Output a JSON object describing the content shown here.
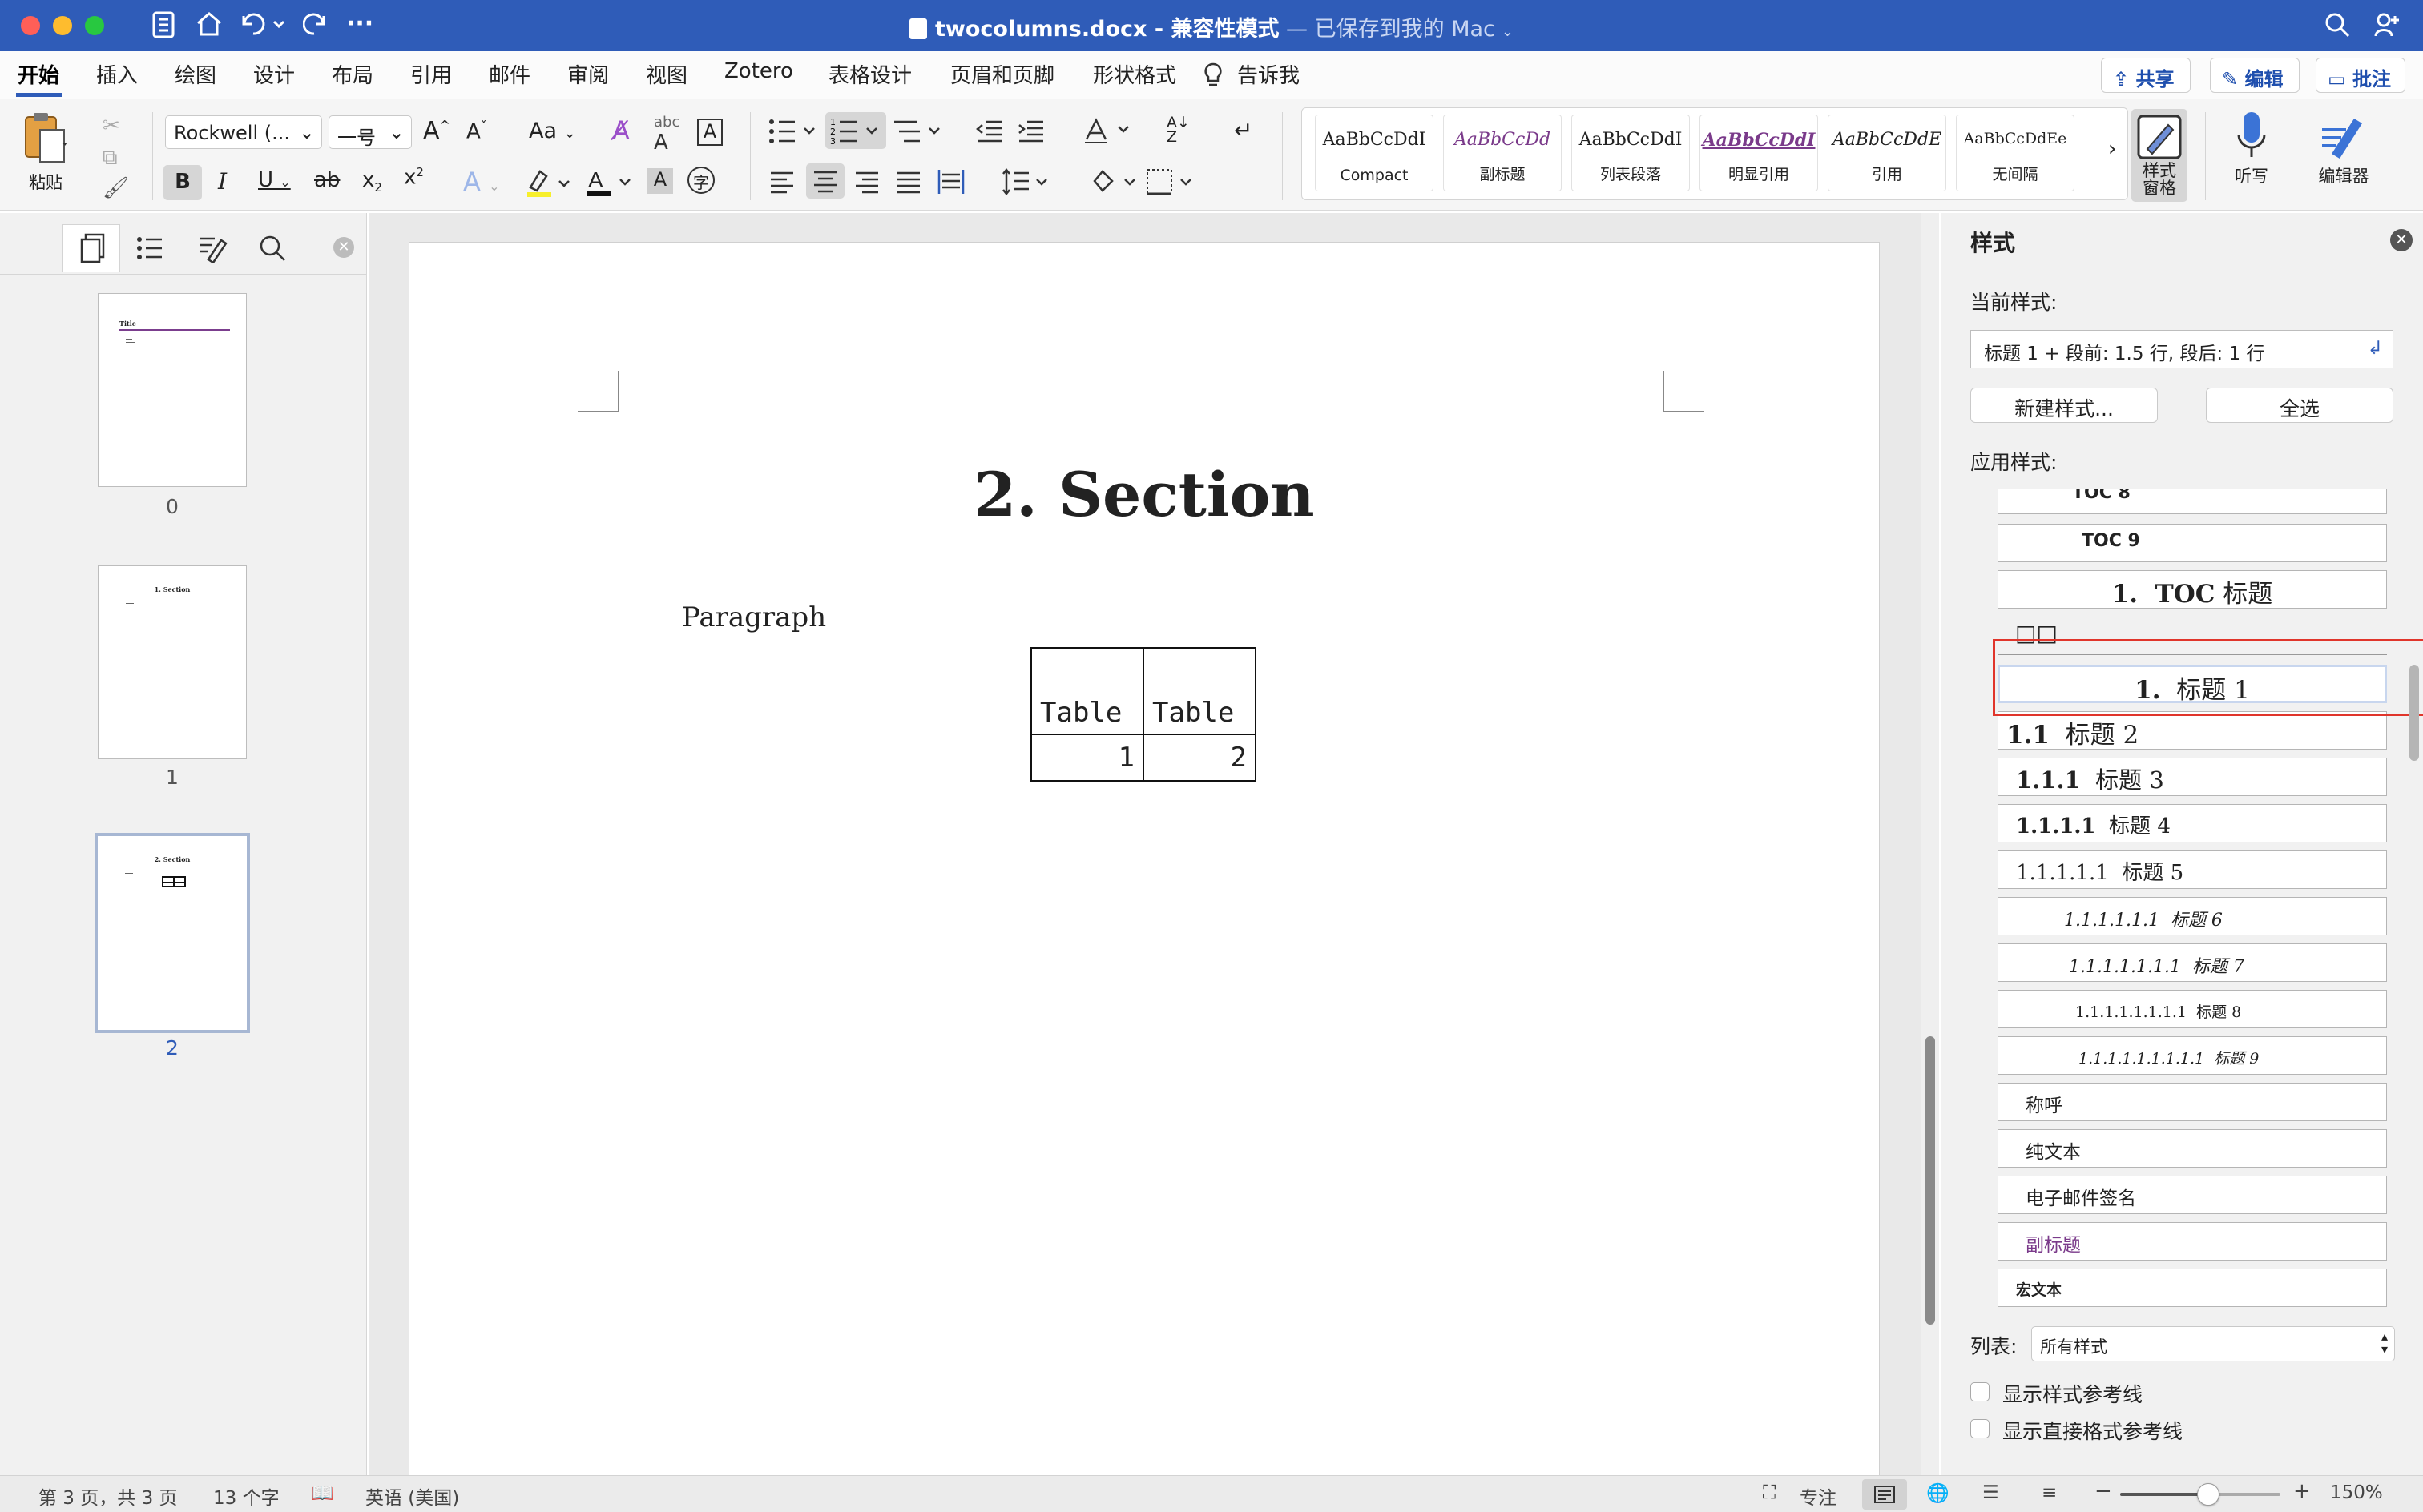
{
  "window": {
    "filename": "twocolumns.docx",
    "separator": " - ",
    "mode": "兼容性模式",
    "save_status": " — 已保存到我的 Mac",
    "accent": "#2f5cb8"
  },
  "tabs": [
    "开始",
    "插入",
    "绘图",
    "设计",
    "布局",
    "引用",
    "邮件",
    "审阅",
    "视图",
    "Zotero",
    "表格设计",
    "页眉和页脚",
    "形状格式"
  ],
  "tell_me": "告诉我",
  "top_buttons": {
    "share": "共享",
    "edit": "编辑",
    "comments": "批注"
  },
  "ribbon": {
    "paste_label": "粘贴",
    "font_name": "Rockwell (...",
    "font_size": "一号",
    "change_case": "Aa",
    "style_gallery": [
      {
        "preview": "AaBbCcDdI",
        "name": "Compact"
      },
      {
        "preview": "AaBbCcDd",
        "name": "副标题"
      },
      {
        "preview": "AaBbCcDdI",
        "name": "列表段落"
      },
      {
        "preview": "AaBbCcDdI",
        "name": "明显引用"
      },
      {
        "preview": "AaBbCcDdE",
        "name": "引用"
      },
      {
        "preview": "AaBbCcDdEe",
        "name": "无间隔"
      }
    ],
    "styles_pane_label_1": "样式",
    "styles_pane_label_2": "窗格",
    "dictate_label": "听写",
    "editor_label": "编辑器"
  },
  "thumbnails": {
    "pages": [
      {
        "num": "0"
      },
      {
        "num": "1"
      },
      {
        "num": "2",
        "active": true
      }
    ],
    "p0_title": "Title",
    "p1_heading": "1. Section",
    "p2_heading": "2. Section"
  },
  "document": {
    "heading": "2. Section",
    "paragraph": "Paragraph",
    "table": [
      [
        "Table",
        "Table"
      ],
      [
        "1",
        "2"
      ]
    ]
  },
  "styles_pane": {
    "title": "样式",
    "current_label": "当前样式:",
    "current_value": "标题 1 + 段前: 1.5 行, 段后: 1 行",
    "new_style": "新建样式...",
    "select_all": "全选",
    "apply_label": "应用样式:",
    "items": [
      {
        "num": "",
        "text": "TOC 8"
      },
      {
        "num": "",
        "text": "TOC 9"
      },
      {
        "num": "1.  TOC",
        "text": " 标题"
      },
      {
        "num": "",
        "text": "□□"
      },
      {
        "num": "1.",
        "text": "  标题 1"
      },
      {
        "num": "1.1",
        "text": "  标题 2"
      },
      {
        "num": "1.1.1",
        "text": "  标题 3"
      },
      {
        "num": "1.1.1.1",
        "text": "  标题 4"
      },
      {
        "num": "1.1.1.1.1",
        "text": "  标题 5"
      },
      {
        "num": "1.1.1.1.1.1",
        "text": "  标题 6"
      },
      {
        "num": "1.1.1.1.1.1.1",
        "text": "  标题 7"
      },
      {
        "num": "1.1.1.1.1.1.1.1",
        "text": "  标题 8"
      },
      {
        "num": "1.1.1.1.1.1.1.1.1",
        "text": "  标题 9"
      },
      {
        "num": "",
        "text": "称呼"
      },
      {
        "num": "",
        "text": "纯文本"
      },
      {
        "num": "",
        "text": "电子邮件签名"
      },
      {
        "num": "",
        "text": "副标题"
      },
      {
        "num": "",
        "text": "宏文本"
      }
    ],
    "list_label": "列表:",
    "list_value": "所有样式",
    "show_guides": "显示样式参考线",
    "show_direct_guides": "显示直接格式参考线",
    "highlight_color": "#e0352b"
  },
  "status": {
    "page": "第 3 页，共 3 页",
    "words": "13 个字",
    "language": "英语 (美国)",
    "focus": "专注",
    "zoom": "150%",
    "zoom_level": 0.55
  }
}
